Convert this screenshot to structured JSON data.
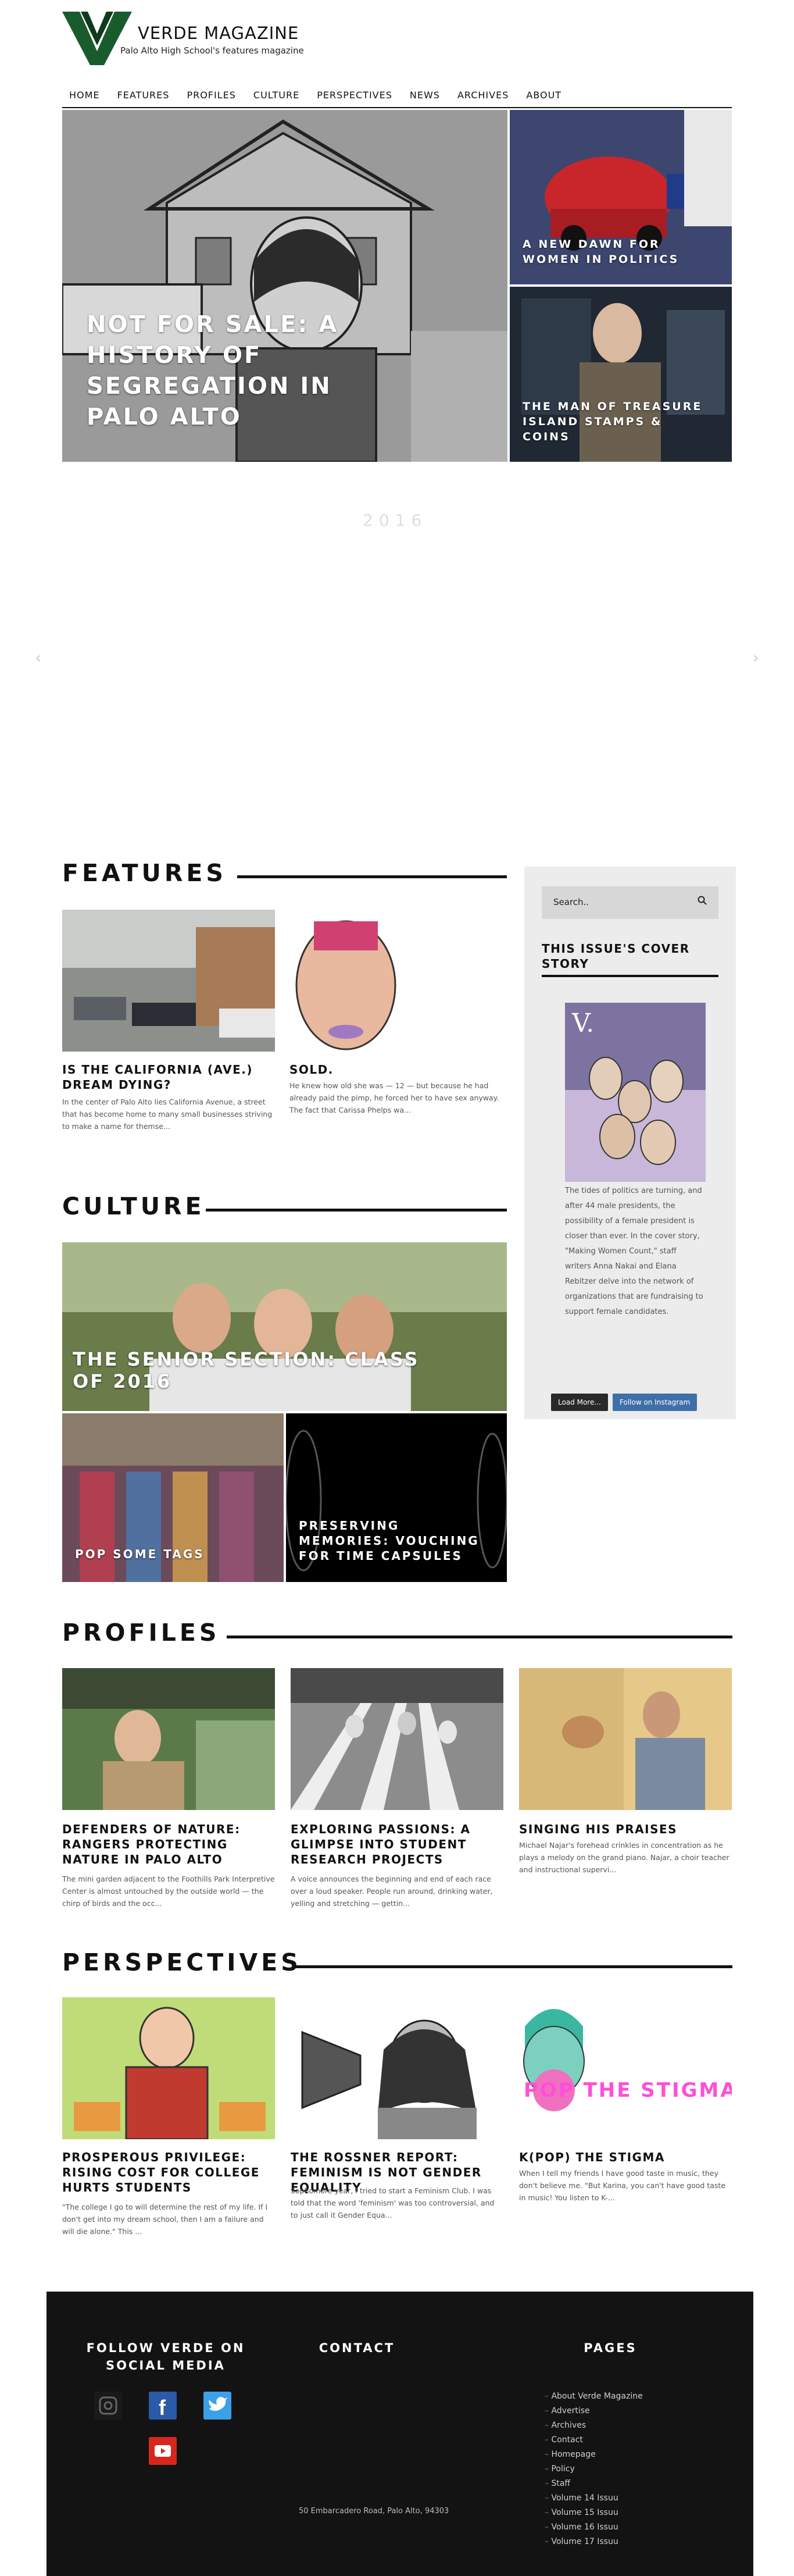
{
  "brand": {
    "title": "VERDE MAGAZINE",
    "subtitle": "Palo Alto High School's features magazine",
    "logo_letter": "V",
    "logo_color": "#1a5b2e"
  },
  "nav": [
    "HOME",
    "FEATURES",
    "PROFILES",
    "CULTURE",
    "PERSPECTIVES",
    "NEWS",
    "ARCHIVES",
    "ABOUT"
  ],
  "hero": {
    "main": {
      "title": "NOT FOR SALE: A HISTORY OF SEGREGATION IN PALO ALTO"
    },
    "side1": {
      "title": "A NEW DAWN FOR WOMEN IN POLITICS"
    },
    "side2": {
      "title": "THE MAN OF TREASURE ISLAND STAMPS & COINS"
    }
  },
  "slider": {
    "logo": "2016"
  },
  "features": {
    "heading": "FEATURES",
    "cards": [
      {
        "title": "IS THE CALIFORNIA (AVE.) DREAM DYING?",
        "excerpt": "In the center of Palo Alto lies California Avenue, a street that has become home to many small businesses striving to make a name for themse..."
      },
      {
        "title": "SOLD.",
        "excerpt": "He knew how old she was — 12 — but because he had already paid the pimp, he forced her to have sex anyway. The fact that Carissa Phelps wa..."
      }
    ]
  },
  "culture": {
    "heading": "CULTURE",
    "main": "THE SENIOR SECTION: CLASS OF 2016",
    "sub1": "POP SOME TAGS",
    "sub2": "PRESERVING MEMORIES: VOUCHING FOR TIME CAPSULES"
  },
  "profiles": {
    "heading": "PROFILES",
    "cards": [
      {
        "title": "DEFENDERS OF NATURE: RANGERS PROTECTING NATURE IN PALO ALTO",
        "excerpt": "The mini garden adjacent to the Foothills Park Interpretive Center is almost untouched by the outside world — the chirp of birds and the occ..."
      },
      {
        "title": "EXPLORING PASSIONS: A GLIMPSE INTO STUDENT RESEARCH PROJECTS",
        "excerpt": "A voice announces the beginning and end of each race over a loud speaker. People run around, drinking water, yelling and stretching — gettin..."
      },
      {
        "title": "SINGING HIS PRAISES",
        "excerpt": "Michael Najar's forehead crinkles in concentration as he plays a melody on the grand piano. Najar, a choir teacher and instructional supervi..."
      }
    ]
  },
  "perspectives": {
    "heading": "PERSPECTIVES",
    "cards": [
      {
        "title": "PROSPEROUS PRIVILEGE: RISING COST FOR COLLEGE HURTS STUDENTS",
        "excerpt": "\"The college I go to will determine the rest of my life. If I don't get into my dream school, then I am a failure and will die alone.\" This ..."
      },
      {
        "title": "THE ROSSNER REPORT: FEMINISM IS NOT GENDER EQUALITY",
        "excerpt": "Sophomore year, I tried to start a Feminism Club. I was told that the word 'feminism' was too controversial, and to just call it Gender Equa..."
      },
      {
        "title": "K(POP) THE STIGMA",
        "excerpt": "When I tell my friends I have good taste in music, they don't believe me. \"But Karina, you can't have good taste in music! You listen to K-..."
      }
    ],
    "kpop_art_text": "POP THE STIGMA"
  },
  "sidebar": {
    "search_placeholder": "Search..",
    "cover_heading": "THIS ISSUE'S COVER STORY",
    "cover_text": "The tides of politics are turning, and after 44 male presidents, the possibility of a female president is closer than ever. In the cover story, \"Making Women Count,\" staff writers Anna Nakai and Elana Rebitzer delve into the network of organizations that are fundraising to support female candidates.",
    "load_more": "Load More...",
    "follow_instagram": "Follow on Instagram"
  },
  "footer": {
    "social_heading": "FOLLOW VERDE ON SOCIAL MEDIA",
    "contact_heading": "CONTACT",
    "pages_heading": "PAGES",
    "address": "50 Embarcadero Road, Palo Alto, 94303",
    "links": [
      "About Verde Magazine",
      "Advertise",
      "Archives",
      "Contact",
      "Homepage",
      "Policy",
      "Staff",
      "Volume 14 Issuu",
      "Volume 15 Issuu",
      "Volume 16 Issuu",
      "Volume 17 Issuu"
    ]
  }
}
